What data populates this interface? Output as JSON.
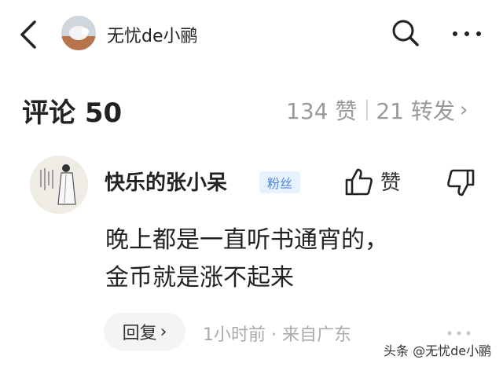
{
  "header": {
    "author_name": "无忧de小鹂",
    "icons": [
      "back-arrow-icon",
      "search-icon",
      "more-dots-icon"
    ]
  },
  "comments_section": {
    "title": "评论 50",
    "likes": "134 赞",
    "reposts": "21 转发",
    "reposts_chevron": "›"
  },
  "comment": {
    "user_name": "快乐的张小呆",
    "badge": "粉丝",
    "like_label": "赞",
    "text_line1": "晚上都是一直听书通宵的，",
    "text_line2": "金币就是涨不起来",
    "reply_label": "回复",
    "reply_chevron": "›",
    "time_location": "1小时前 · 来自广东"
  },
  "watermark": "头条 @无忧de小鹂",
  "colors": {
    "text_primary": "#222222",
    "text_secondary": "#999999",
    "badge_bg": "#e8f1ff",
    "badge_text": "#4a84d8"
  }
}
